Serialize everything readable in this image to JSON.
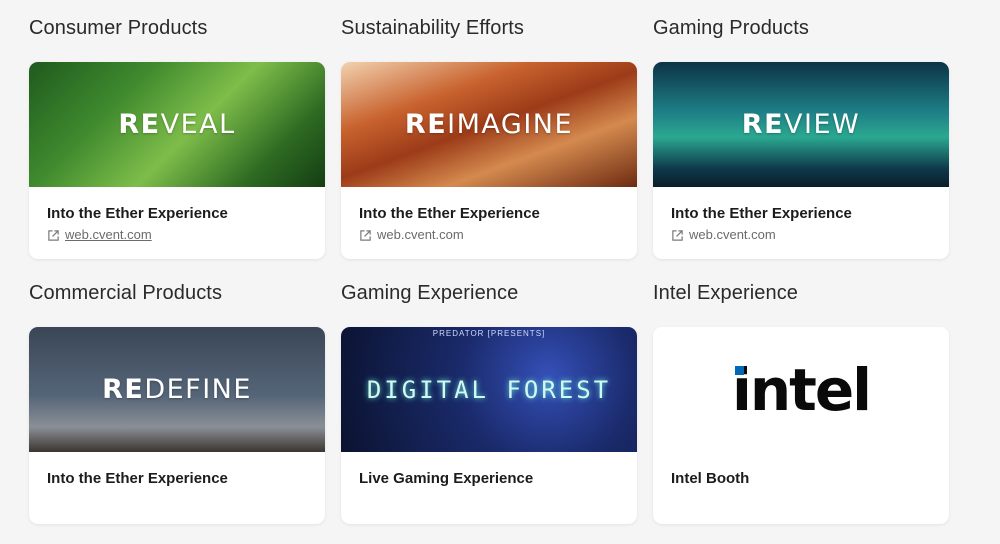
{
  "sections": [
    {
      "title": "Consumer Products",
      "banner_bold": "RE",
      "banner_rest": "VEAL",
      "card_title": "Into the Ether Experience",
      "link_text": "web.cvent.com",
      "link_underlined": true,
      "banner_icon": "leaf-image"
    },
    {
      "title": "Sustainability Efforts",
      "banner_bold": "RE",
      "banner_rest": "IMAGINE",
      "card_title": "Into the Ether Experience",
      "link_text": "web.cvent.com",
      "banner_icon": "canyon-image"
    },
    {
      "title": "Gaming Products",
      "banner_bold": "RE",
      "banner_rest": "VIEW",
      "card_title": "Into the Ether Experience",
      "link_text": "web.cvent.com",
      "banner_icon": "aurora-image"
    },
    {
      "title": "Commercial Products",
      "banner_bold": "RE",
      "banner_rest": "DEFINE",
      "card_title": "Into the Ether Experience",
      "banner_icon": "mountain-image"
    },
    {
      "title": "Gaming Experience",
      "banner_text": "DIGITAL FOREST",
      "banner_subtext": "PREDATOR [PRESENTS]",
      "card_title": "Live Gaming Experience",
      "banner_icon": "forest-image"
    },
    {
      "title": "Intel Experience",
      "banner_text": "intel",
      "card_title": "Intel Booth",
      "banner_icon": "intel-logo"
    }
  ],
  "colors": {
    "page_background": "#f5f5f5",
    "card_background": "#ffffff",
    "link_color": "#6b6b6b",
    "intel_blue": "#0068b5"
  }
}
